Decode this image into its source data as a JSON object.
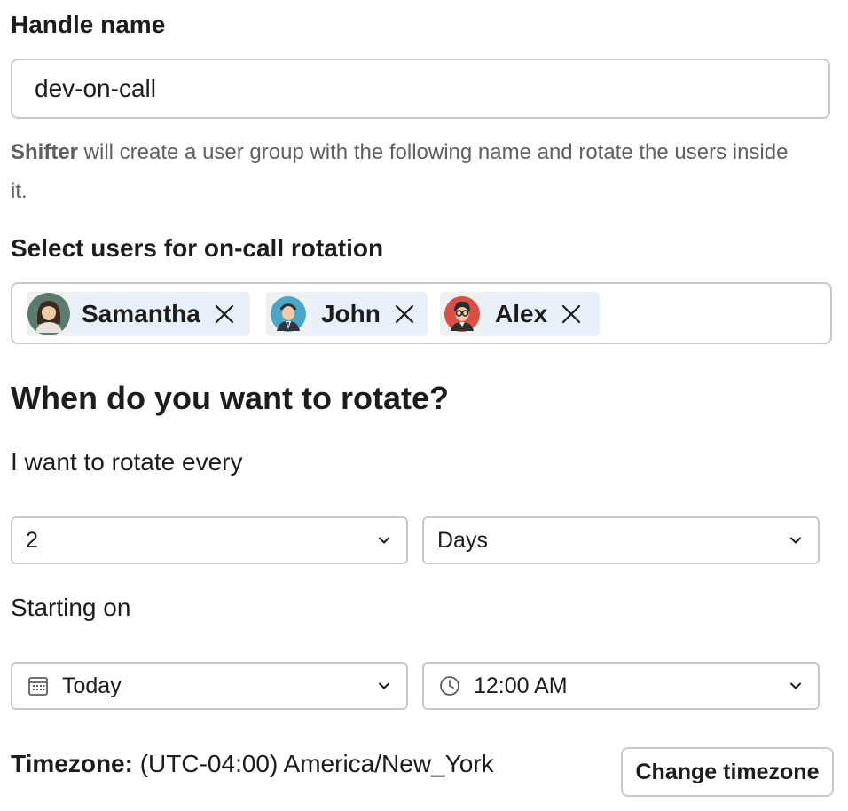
{
  "handle": {
    "label": "Handle name",
    "value": "dev-on-call"
  },
  "hint": {
    "app_name": "Shifter",
    "text": " will create a user group with the following name and rotate the users inside it."
  },
  "users": {
    "label": "Select users for on-call rotation",
    "selected": [
      {
        "name": "Samantha",
        "avatar": "woman-avatar-icon"
      },
      {
        "name": "John",
        "avatar": "man-tie-avatar-icon"
      },
      {
        "name": "Alex",
        "avatar": "glasses-avatar-icon"
      }
    ]
  },
  "rotation": {
    "heading": "When do you want to rotate?",
    "every_label": "I want to rotate every",
    "interval_value": "2",
    "unit_value": "Days",
    "starting_label": "Starting on",
    "date_value": "Today",
    "time_value": "12:00 AM"
  },
  "timezone": {
    "label": "Timezone:",
    "value": " (UTC-04:00) America/New_York",
    "change_button": "Change timezone"
  },
  "colors": {
    "chip_bg": "#e8f1f9",
    "border": "#c9c9c9",
    "hint_text": "#616061",
    "text": "#1d1c1d"
  }
}
